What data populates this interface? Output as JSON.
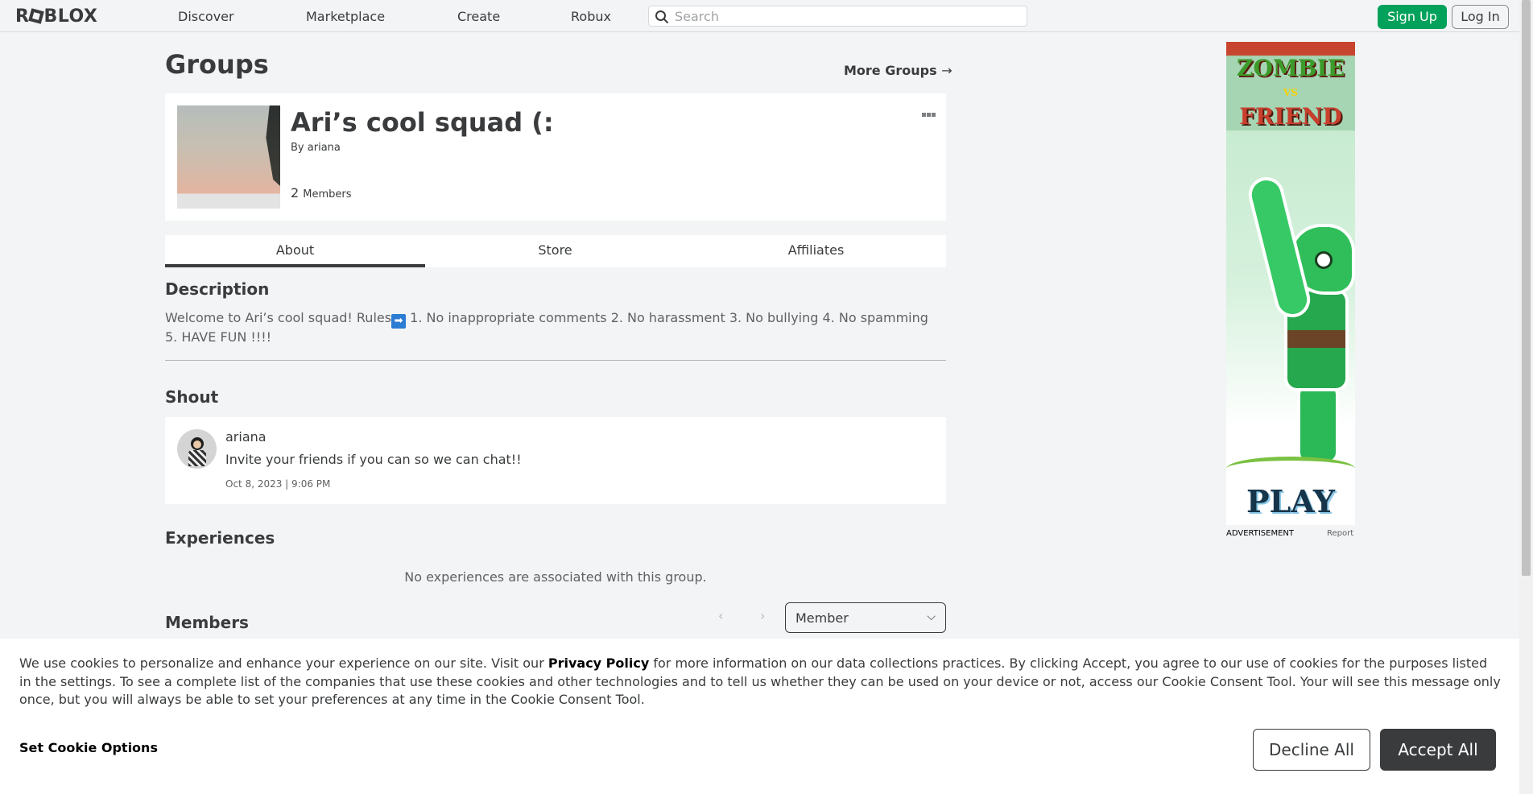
{
  "nav": {
    "logo": "ROBLOX",
    "links": [
      "Discover",
      "Marketplace",
      "Create",
      "Robux"
    ],
    "search_placeholder": "Search",
    "sign_up": "Sign Up",
    "log_in": "Log In"
  },
  "page": {
    "title": "Groups",
    "more_groups": "More Groups",
    "more_groups_arrow": "→"
  },
  "group": {
    "name": "Ari’s cool squad (:",
    "by_label": "By",
    "owner": "ariana",
    "member_count": "2",
    "members_label": "Members"
  },
  "tabs": [
    {
      "label": "About",
      "active": true
    },
    {
      "label": "Store",
      "active": false
    },
    {
      "label": "Affiliates",
      "active": false
    }
  ],
  "description": {
    "heading": "Description",
    "text_before": "Welcome to Ari’s cool squad! Rules",
    "emoji": "➡",
    "text_after": " 1. No inappropriate comments 2. No harassment 3. No bullying 4. No spamming 5. HAVE FUN !!!!"
  },
  "shout": {
    "heading": "Shout",
    "user": "ariana",
    "message": "Invite your friends if you can so we can chat!!",
    "date": "Oct 8, 2023 | 9:06 PM"
  },
  "experiences": {
    "heading": "Experiences",
    "empty": "No experiences are associated with this group."
  },
  "members": {
    "heading": "Members",
    "role_selected": "Member",
    "prev": "‹",
    "next": "›",
    "chevron": "⌵"
  },
  "ad": {
    "title_top": "ZOMBIE",
    "title_vs": "VS",
    "title_bottom": "FRIEND",
    "cta": "PLAY",
    "label": "ADVERTISEMENT",
    "report": "Report"
  },
  "cookie": {
    "text_1": "We use cookies to personalize and enhance your experience on our site. Visit our ",
    "privacy_link": "Privacy Policy",
    "text_2": " for more information on our data collections practices. By clicking Accept, you agree to our use of cookies for the purposes listed in the settings. To see a complete list of the companies that use these cookies and other technologies and to tell us whether they can be used on your device or not, access our Cookie Consent Tool. Your will see this message only once, but you will always be able to set your preferences at any time in the Cookie Consent Tool.",
    "options": "Set Cookie Options",
    "decline": "Decline All",
    "accept": "Accept All"
  },
  "colors": {
    "signup_green": "#00a15a",
    "text_dark": "#393b3d",
    "page_bg": "#f2f4f5"
  },
  "icons": {
    "search": "search-icon",
    "more": "more-options-icon",
    "arrow": "arrow-right-icon"
  }
}
